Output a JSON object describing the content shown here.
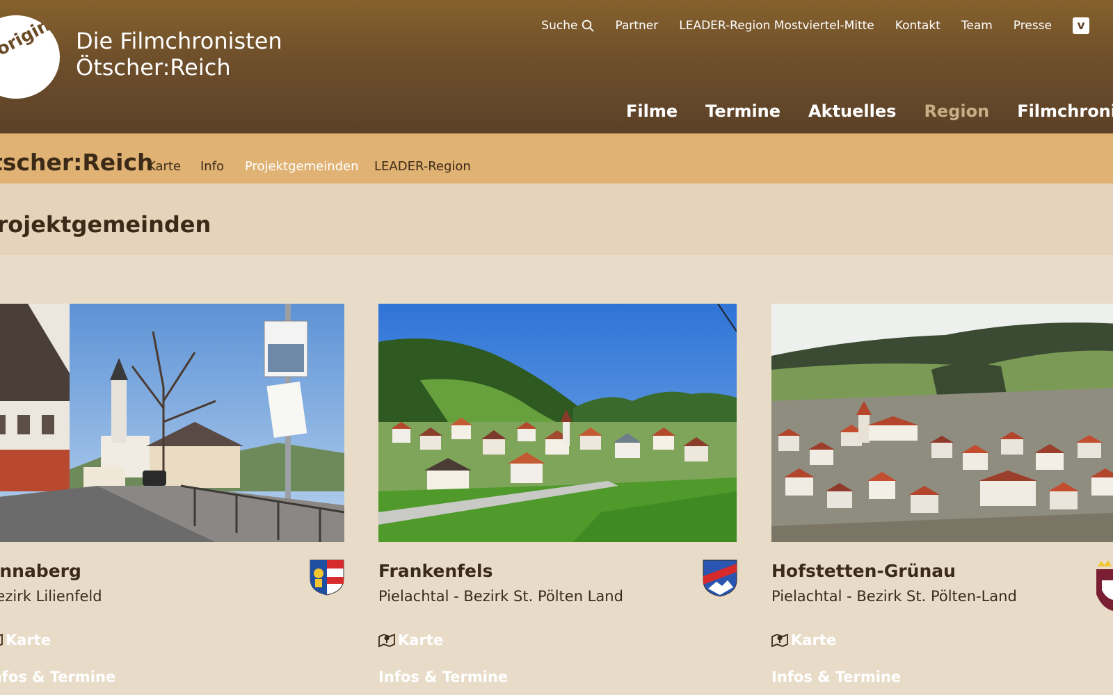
{
  "header": {
    "logo_text": "original",
    "site_title_line1": "Die Filmchronisten",
    "site_title_line2": "Ötscher:Reich",
    "top_nav": {
      "search": "Suche",
      "partner": "Partner",
      "leader": "LEADER-Region Mostviertel-Mitte",
      "kontakt": "Kontakt",
      "team": "Team",
      "presse": "Presse",
      "vimeo_icon": "vimeo-icon"
    },
    "main_nav": {
      "filme": "Filme",
      "termine": "Termine",
      "aktuelles": "Aktuelles",
      "region": "Region",
      "filmchronisten": "Filmchronisten"
    }
  },
  "subnav": {
    "title": "Ötscher:Reich",
    "items": [
      "Karte",
      "Info",
      "Projektgemeinden",
      "LEADER-Region"
    ],
    "active_item": "Projektgemeinden"
  },
  "page": {
    "heading": "Projektgemeinden"
  },
  "cards": [
    {
      "title": "Annaberg",
      "subtitle": "Bezirk Lilienfeld",
      "karte_label": "Karte",
      "infos_label": "Infos & Termine"
    },
    {
      "title": "Frankenfels",
      "subtitle": "Pielachtal - Bezirk St. Pölten Land",
      "karte_label": "Karte",
      "infos_label": "Infos & Termine"
    },
    {
      "title": "Hofstetten-Grünau",
      "subtitle": "Pielachtal - Bezirk St. Pölten-Land",
      "karte_label": "Karte",
      "infos_label": "Infos & Termine"
    }
  ],
  "colors": {
    "header_brown": "#6e4f2b",
    "subnav_orange": "#e0b273",
    "page_beige": "#e8dcc9",
    "text_dark": "#3b2a17",
    "active_nav": "#c9ad86"
  }
}
